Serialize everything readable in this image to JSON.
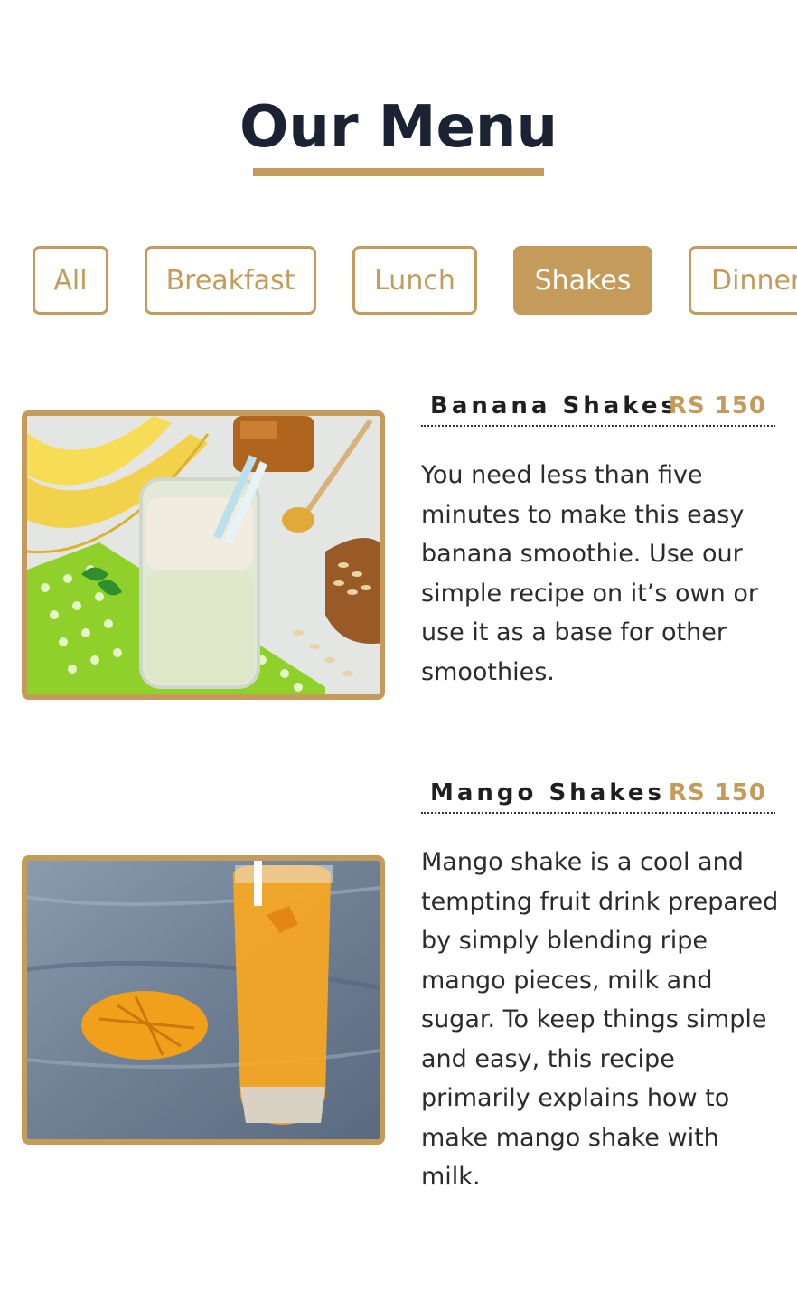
{
  "header": {
    "title": "Our Menu"
  },
  "filters": [
    {
      "label": "All",
      "active": false
    },
    {
      "label": "Breakfast",
      "active": false
    },
    {
      "label": "Lunch",
      "active": false
    },
    {
      "label": "Shakes",
      "active": true
    },
    {
      "label": "Dinner",
      "active": false
    }
  ],
  "items": [
    {
      "name": "Banana Shakes",
      "price": "RS 150",
      "description": "You need less than five minutes to make this easy banana smoothie. Use our simple recipe on it’s own or use it as a base for other smoothies."
    },
    {
      "name": "Mango Shakes",
      "price": "RS 150",
      "description": "Mango shake is a cool and tempting fruit drink prepared by simply blending ripe mango pieces, milk and sugar. To keep things simple and easy, this recipe primarily explains how to make mango shake with milk."
    }
  ],
  "colors": {
    "accent": "#c49b5b",
    "title": "#1b2233",
    "text": "#2b2b2b"
  }
}
